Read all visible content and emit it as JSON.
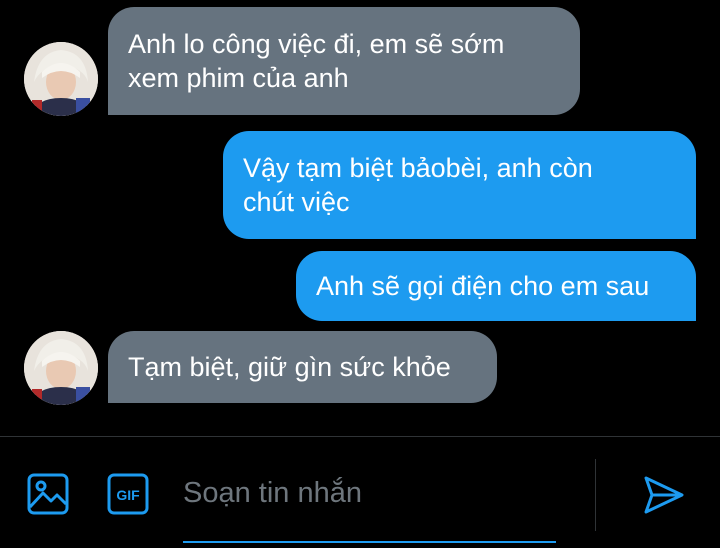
{
  "messages": [
    {
      "direction": "in",
      "lines": [
        "Anh lo công việc đi, em sẽ sớm",
        "xem phim của anh"
      ]
    },
    {
      "direction": "out",
      "lines": [
        "Vậy tạm biệt bảobèi, anh còn",
        "chút việc"
      ]
    },
    {
      "direction": "out",
      "lines": [
        "Anh sẽ gọi điện cho em sau"
      ]
    },
    {
      "direction": "in",
      "lines": [
        "Tạm biệt, giữ gìn sức khỏe"
      ]
    }
  ],
  "composer": {
    "placeholder": "Soạn tin nhắn",
    "value": "",
    "image_icon": "image-icon",
    "gif_icon": "gif-icon",
    "gif_label": "GIF",
    "send_icon": "send-icon"
  },
  "colors": {
    "background": "#000000",
    "incoming_bubble": "#66737f",
    "outgoing_bubble": "#1d9bf0",
    "accent": "#1d9bf0"
  }
}
